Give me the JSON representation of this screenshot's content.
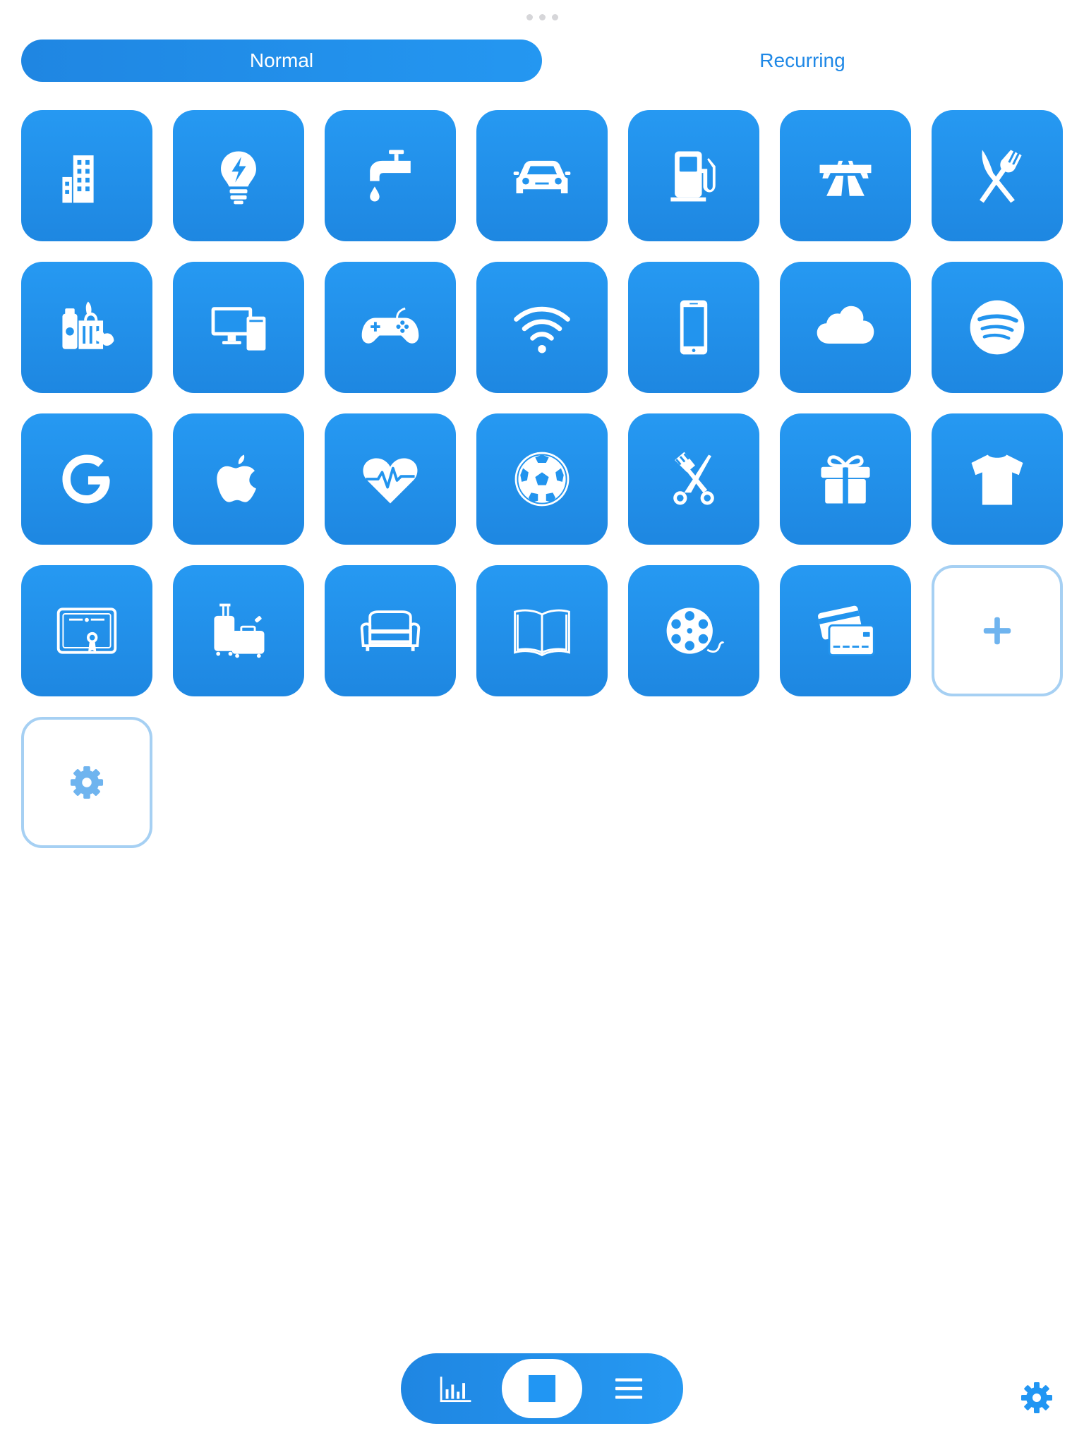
{
  "segmented": {
    "options": [
      "Normal",
      "Recurring"
    ],
    "selected": "Normal"
  },
  "categories": [
    {
      "icon": "building-icon"
    },
    {
      "icon": "lightbulb-icon"
    },
    {
      "icon": "water-tap-icon"
    },
    {
      "icon": "car-icon"
    },
    {
      "icon": "fuel-pump-icon"
    },
    {
      "icon": "highway-icon"
    },
    {
      "icon": "fork-knife-icon"
    },
    {
      "icon": "groceries-icon"
    },
    {
      "icon": "computer-icon"
    },
    {
      "icon": "gamepad-icon"
    },
    {
      "icon": "wifi-icon"
    },
    {
      "icon": "smartphone-icon"
    },
    {
      "icon": "cloud-icon"
    },
    {
      "icon": "spotify-icon"
    },
    {
      "icon": "google-icon"
    },
    {
      "icon": "apple-icon"
    },
    {
      "icon": "heart-pulse-icon"
    },
    {
      "icon": "soccer-ball-icon"
    },
    {
      "icon": "barber-scissors-comb-icon"
    },
    {
      "icon": "gift-icon"
    },
    {
      "icon": "tshirt-icon"
    },
    {
      "icon": "certificate-icon"
    },
    {
      "icon": "luggage-icon"
    },
    {
      "icon": "sofa-icon"
    },
    {
      "icon": "open-book-icon"
    },
    {
      "icon": "film-reel-icon"
    },
    {
      "icon": "credit-cards-icon"
    }
  ],
  "actions": [
    {
      "icon": "plus-icon"
    },
    {
      "icon": "gear-icon"
    }
  ],
  "tabbar": {
    "tabs": [
      {
        "icon": "bar-chart-icon"
      },
      {
        "icon": "square-icon"
      },
      {
        "icon": "list-icon"
      }
    ],
    "selected": "square-icon"
  },
  "colors": {
    "accent": "#2196F3",
    "tile_top": "#2699F2",
    "tile_bottom": "#1E87E1",
    "outline": "#A6D0F3",
    "white": "#FFFFFF"
  }
}
